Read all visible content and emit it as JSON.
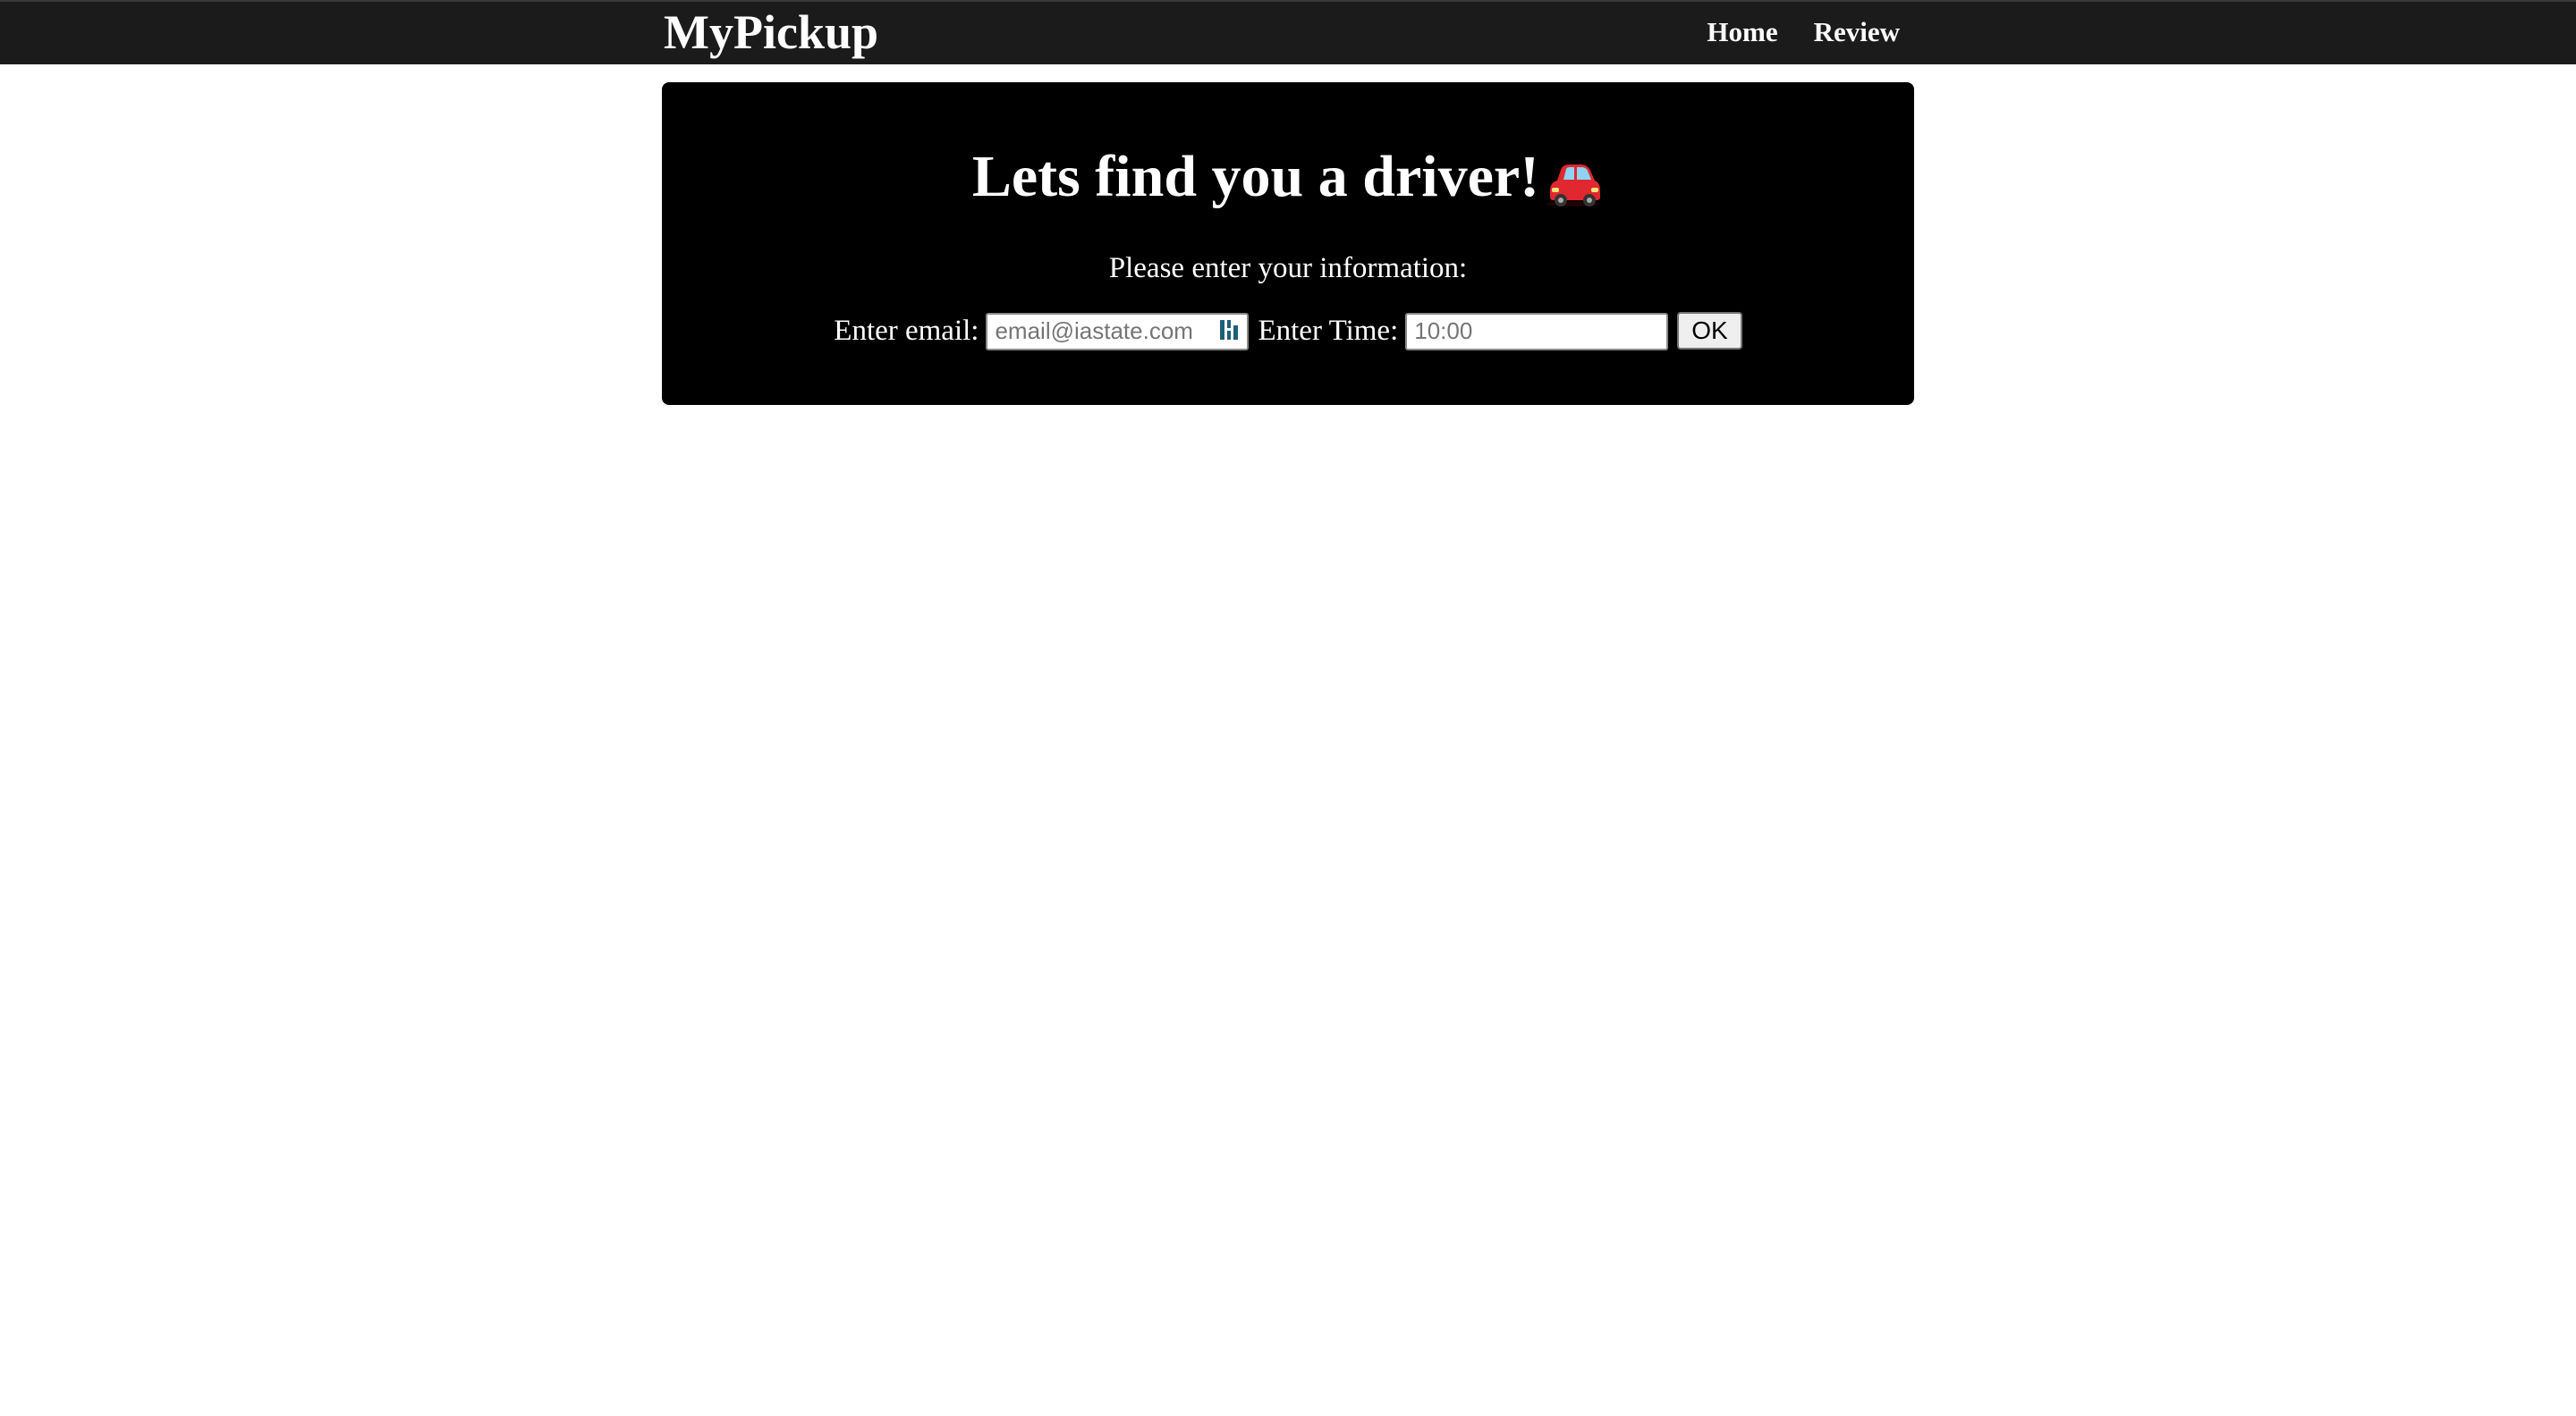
{
  "nav": {
    "brand": "MyPickup",
    "links": [
      {
        "label": "Home"
      },
      {
        "label": "Review"
      }
    ]
  },
  "hero": {
    "title": "Lets find you a driver!",
    "title_icon": "red-car-icon",
    "prompt": "Please enter your information:"
  },
  "form": {
    "email_label": "Enter email:",
    "email_placeholder": "email@iastate.com",
    "email_icon": "password-manager-icon",
    "time_label": "Enter Time:",
    "time_placeholder": "10:00",
    "submit_label": "OK"
  },
  "colors": {
    "navbar": "#1b1b1b",
    "panel": "#000000",
    "text": "#ffffff",
    "car": "#e0282e",
    "manager_icon": "#1d5f7a"
  }
}
